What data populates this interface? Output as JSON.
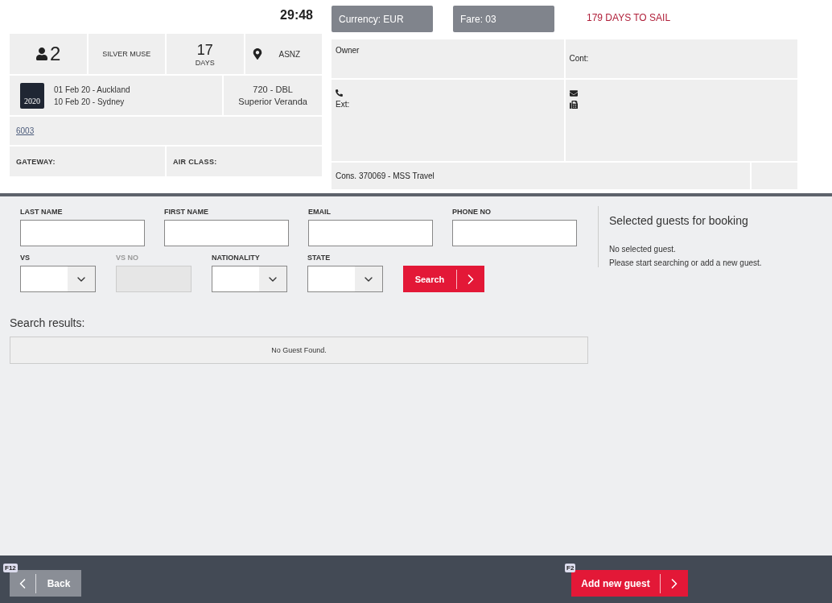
{
  "header": {
    "timer": "29:48",
    "pills": [
      "Currency: EUR",
      "Fare: 03"
    ],
    "days_to_sail": "179 DAYS TO SAIL"
  },
  "trip": {
    "guests": "2",
    "ship": "SILVER MUSE",
    "days_number": "17",
    "days_label": "DAYS",
    "region": "ASNZ",
    "calendar_year": "2020",
    "itinerary": [
      "01 Feb 20 - Auckland",
      "10 Feb 20 - Sydney"
    ],
    "cabin": [
      "720 - DBL",
      "Superior Veranda"
    ],
    "booking_link": "6003",
    "gateway_label": "GATEWAY:",
    "air_class_label": "AIR CLASS:"
  },
  "contact": {
    "owner_label": "Owner",
    "cont_label": "Cont:",
    "ext_label": "Ext:",
    "consultant": "Cons. 370069 - MSS Travel"
  },
  "search_form": {
    "text_fields": [
      {
        "label": "LAST NAME",
        "kind": "text",
        "disabled": false
      },
      {
        "label": "FIRST NAME",
        "kind": "text",
        "disabled": false
      },
      {
        "label": "EMAIL",
        "kind": "text",
        "disabled": false
      },
      {
        "label": "PHONE NO",
        "kind": "text",
        "disabled": false
      }
    ],
    "filters": [
      {
        "label": "VS",
        "kind": "select",
        "disabled": false
      },
      {
        "label": "VS NO",
        "kind": "text",
        "disabled": true
      },
      {
        "label": "NATIONALITY",
        "kind": "select",
        "disabled": false
      },
      {
        "label": "STATE",
        "kind": "select",
        "disabled": false
      }
    ],
    "search_button": "Search"
  },
  "results": {
    "label": "Search results:",
    "empty_message": "No Guest Found."
  },
  "selected_panel": {
    "title": "Selected guests for booking",
    "lines": [
      "No selected guest.",
      "Please start searching or add a new guest."
    ]
  },
  "footer": {
    "buttons": [
      {
        "label": "Back",
        "key": "F12",
        "kind": "back"
      },
      {
        "label": "Add new guest",
        "key": "F2",
        "kind": "next"
      }
    ]
  }
}
